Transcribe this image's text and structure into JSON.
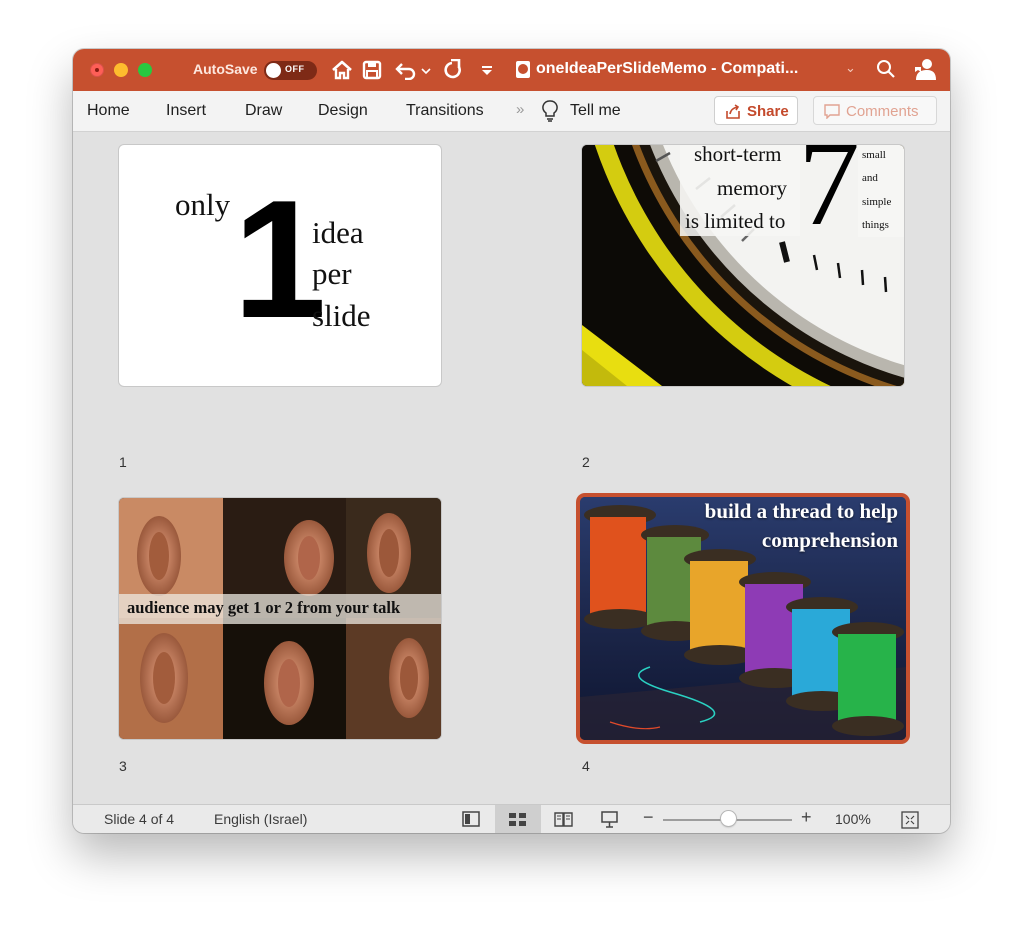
{
  "titlebar": {
    "autosave_label": "AutoSave",
    "autosave_state": "OFF",
    "document_title": "oneIdeaPerSlideMemo - Compati...",
    "accent_color": "#c6502f"
  },
  "ribbon": {
    "tabs": [
      "Home",
      "Insert",
      "Draw",
      "Design",
      "Transitions"
    ],
    "overflow": "»",
    "tell_me": "Tell me",
    "share_label": "Share",
    "comments_label": "Comments"
  },
  "slides": [
    {
      "number": "1",
      "big_number": "1",
      "word_only": "only",
      "word_idea": "idea",
      "word_per": "per",
      "word_slide": "slide"
    },
    {
      "number": "2",
      "line1": "short-term",
      "line2": "memory",
      "line3": "is limited to",
      "big_number": "7",
      "side1": "small",
      "side2": "and",
      "side3": "simple",
      "side4": "things"
    },
    {
      "number": "3",
      "caption": "audience may get 1 or 2 from your talk"
    },
    {
      "number": "4",
      "line1": "build a thread to help",
      "line2": "comprehension"
    }
  ],
  "selected_slide": "4",
  "statusbar": {
    "slide_info": "Slide 4 of 4",
    "language": "English (Israel)",
    "zoom": "100%",
    "zoom_minus": "−",
    "zoom_plus": "+"
  },
  "icons": {
    "home": "home-icon",
    "save": "save-icon",
    "undo": "undo-icon",
    "redo": "redo-icon",
    "customize": "customize-toolbar-icon",
    "search": "search-icon",
    "person": "person-icon",
    "bulb": "lightbulb-icon",
    "share": "share-icon",
    "comment": "comment-icon"
  }
}
